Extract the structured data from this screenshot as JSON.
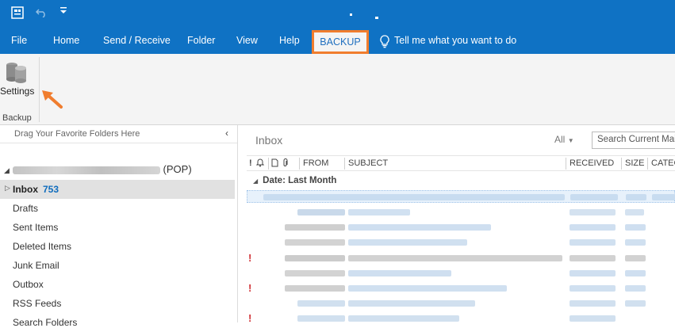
{
  "quick_access": {
    "app_icon": "outlook-app-icon",
    "undo_icon": "undo-icon",
    "customize_icon": "qat-dropdown-icon"
  },
  "tabs": [
    {
      "label": "File"
    },
    {
      "label": "Home"
    },
    {
      "label": "Send / Receive"
    },
    {
      "label": "Folder"
    },
    {
      "label": "View"
    },
    {
      "label": "Help"
    }
  ],
  "active_tab": {
    "label": "BACKUP"
  },
  "tell_me": {
    "label": "Tell me what you want to do",
    "icon": "lightbulb-icon"
  },
  "ribbon": {
    "settings_label": "Settings",
    "settings_icon": "database-icon",
    "group_label": "Backup"
  },
  "folder_pane": {
    "drag_hint": "Drag Your Favorite Folders Here",
    "collapse_icon": "chevron-left-icon",
    "account_suffix": "(POP)",
    "inbox": {
      "label": "Inbox",
      "count": "753"
    },
    "folders": [
      {
        "label": "Drafts"
      },
      {
        "label": "Sent Items"
      },
      {
        "label": "Deleted Items"
      },
      {
        "label": "Junk Email"
      },
      {
        "label": "Outbox"
      },
      {
        "label": "RSS Feeds"
      },
      {
        "label": "Search Folders"
      }
    ]
  },
  "message_list": {
    "title": "Inbox",
    "filter": "All",
    "search_placeholder": "Search Current Mailbox",
    "columns": {
      "importance": "!",
      "reminder_icon": "bell-icon",
      "icon_col": "document-icon",
      "attachment_icon": "paperclip-icon",
      "from": "FROM",
      "subject": "SUBJECT",
      "received": "RECEIVED",
      "size": "SIZE",
      "categories": "CATEG"
    },
    "group_header": "Date: Last Month"
  },
  "colors": {
    "ribbon_blue": "#0f72c4",
    "highlight_orange": "#f07d2e",
    "importance_red": "#d13438"
  }
}
